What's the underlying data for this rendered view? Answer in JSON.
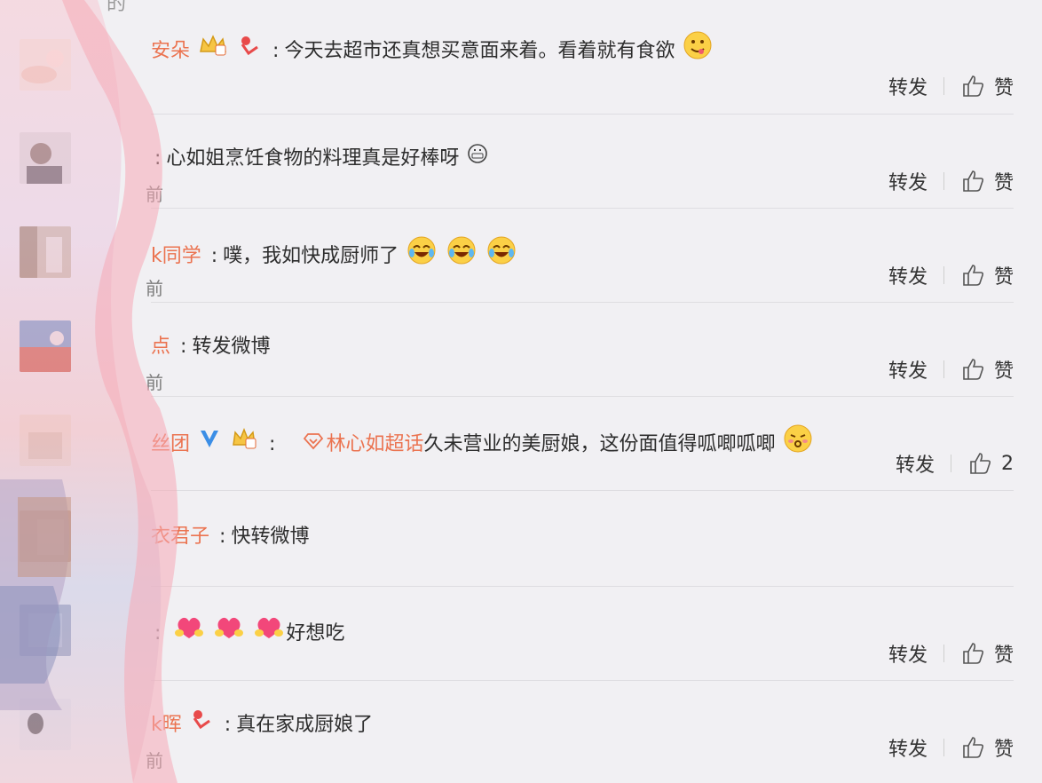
{
  "top_fragment": "的",
  "actions": {
    "forward_label": "转发",
    "like_label": "赞"
  },
  "comments": [
    {
      "username": "安朵",
      "text": "今天去超市还真想买意面来着。看着就有食欲",
      "time": "",
      "like_count": ""
    },
    {
      "username": "",
      "text": "心如姐烹饪食物的料理真是好棒呀",
      "time": "前",
      "like_count": ""
    },
    {
      "username": "k同学",
      "text": "噗，我如快成厨师了",
      "time": "前",
      "like_count": ""
    },
    {
      "username": "点",
      "text": "转发微博",
      "time": "前",
      "like_count": ""
    },
    {
      "username": "丝团",
      "mention": "林心如超话",
      "text": "久未营业的美厨娘，这份面值得呱唧呱唧",
      "time": "",
      "like_count": "2"
    },
    {
      "username": "衣君子",
      "text": "快转微博",
      "time": "",
      "like_count": ""
    },
    {
      "username": "",
      "text": "好想吃",
      "time": "",
      "like_count": ""
    },
    {
      "username": "k晖",
      "text": "真在家成厨娘了",
      "time": "前",
      "like_count": ""
    }
  ],
  "colors": {
    "username": "#eb7350",
    "text": "#2d2d2d",
    "background": "#f1f0f3"
  }
}
